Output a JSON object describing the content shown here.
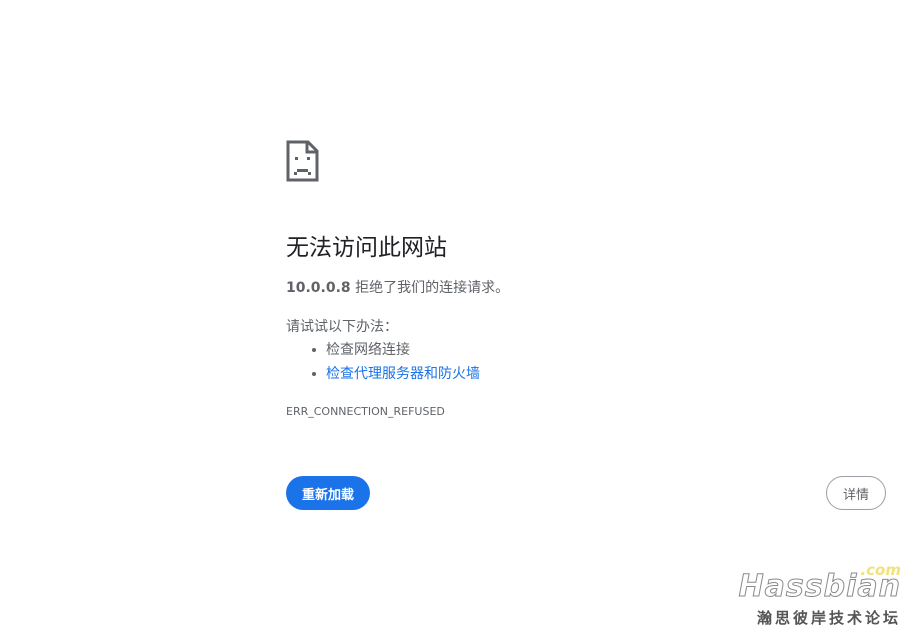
{
  "error_page": {
    "title": "无法访问此网站",
    "host": "10.0.0.8",
    "description_suffix": " 拒绝了我们的连接请求。",
    "suggestions_heading": "请试试以下办法：",
    "suggestions": [
      {
        "label": "检查网络连接",
        "is_link": false
      },
      {
        "label": "检查代理服务器和防火墙",
        "is_link": true
      }
    ],
    "error_code": "ERR_CONNECTION_REFUSED",
    "reload_label": "重新加载",
    "details_label": "详情",
    "icon": "sad-page-icon"
  },
  "watermark": {
    "domain_suffix": ".com",
    "brand": "Hassbian",
    "tagline": "瀚思彼岸技术论坛"
  },
  "colors": {
    "accent": "#1a73e8",
    "text_primary": "#202124",
    "text_secondary": "#5f6368"
  }
}
